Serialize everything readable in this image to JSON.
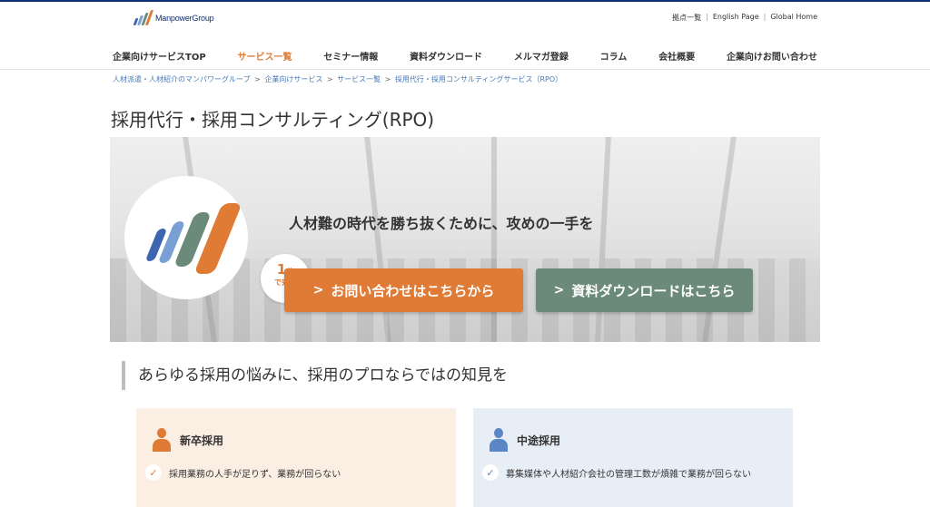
{
  "header": {
    "logo_text": "ManpowerGroup",
    "utility": [
      "拠点一覧",
      "English Page",
      "Global Home"
    ],
    "utility_sep": "|"
  },
  "nav": [
    "企業向けサービスTOP",
    "サービス一覧",
    "セミナー情報",
    "資料ダウンロード",
    "メルマガ登録",
    "コラム",
    "会社概要",
    "企業向けお問い合わせ"
  ],
  "nav_active_index": 1,
  "breadcrumb": [
    "人材派遣・人材紹介のマンパワーグループ",
    "企業向けサービス",
    "サービス一覧",
    "採用代行・採用コンサルティングサービス（RPO）"
  ],
  "breadcrumb_sep": ">",
  "page_title": "採用代行・採用コンサルティング(RPO)",
  "hero": {
    "tagline": "人材難の時代を勝ち抜くために、攻めの一手を",
    "badge_number": "1",
    "badge_unit": "分",
    "badge_text": "で完了",
    "contact_button": "お問い合わせはこちらから",
    "docs_button": "資料ダウンロードはこちら",
    "chevron": ">"
  },
  "section_heading": "あらゆる採用の悩みに、採用のプロならではの知見を",
  "cards": [
    {
      "title": "新卒採用",
      "item": "採用業務の人手が足りず、業務が回らない"
    },
    {
      "title": "中途採用",
      "item": "募集媒体や人材紹介会社の管理工数が煩雑で業務が回らない"
    }
  ],
  "colors": {
    "brand_navy": "#0c2f73",
    "accent_orange": "#e07b35",
    "docs_green": "#6b8a79",
    "link_blue": "#4a78b4",
    "logo_bar_1": "#3e66b0",
    "logo_bar_2": "#7a9fd4",
    "logo_bar_3": "#6b8a79",
    "logo_bar_4": "#e07b35"
  },
  "icons": {
    "card_new": "person-orange-icon",
    "card_mid": "person-blue-icon",
    "check": "check-icon"
  }
}
